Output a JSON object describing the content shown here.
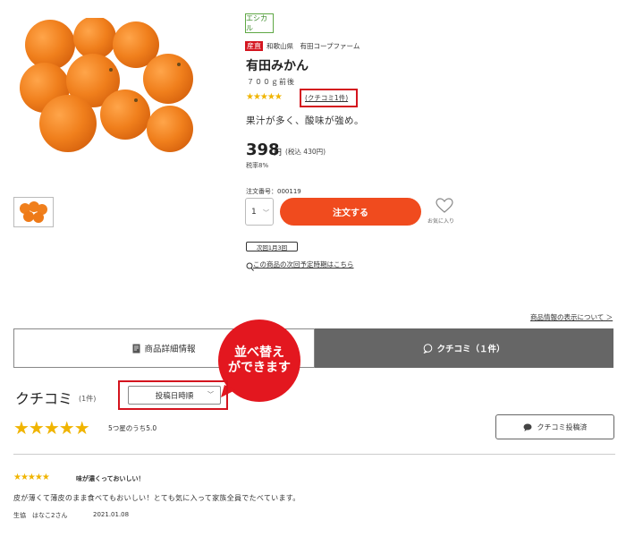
{
  "product": {
    "ethical_badge": "エシカル",
    "origin_tag": "産直",
    "origin_text": "和歌山県　有田コープファーム",
    "name": "有田みかん",
    "weight": "７００ｇ前後",
    "stars": "★★★★★",
    "review_link": "(クチコミ1件)",
    "description": "果汁が多く、酸味が強め。",
    "price": "398",
    "yen": "円",
    "tax_included": "(税込 430円)",
    "tax_rate": "税率8%",
    "order_number": "注文番号：000119",
    "quantity": "1",
    "order_button": "注文する",
    "favorite_label": "お気に入り",
    "next_badge": "次回1月3回",
    "schedule_link": "この商品の次回予定時期はこちら",
    "display_link": "商品情報の表示について ＞"
  },
  "tabs": {
    "detail": "商品詳細情報",
    "review": "クチコミ（１件）"
  },
  "annotation": {
    "line1": "並べ替え",
    "line2": "ができます"
  },
  "reviews": {
    "title": "クチコミ",
    "count": "(1件)",
    "sort_value": "投稿日時順",
    "stars": "★★★★★",
    "rating_text": "5つ星のうち5.0",
    "post_button": "クチコミ投稿済",
    "items": [
      {
        "stars": "★★★★★",
        "title": "味が濃くっておいしい！",
        "body": "皮が薄くて薄皮のまま食べてもおいしい！とても気に入って家族全員でたべています。",
        "author": "生協　はなこ2さん",
        "date": "2021.01.08"
      }
    ]
  },
  "colors": {
    "accent_red": "#d4141e",
    "order_orange": "#f04b1e",
    "star_gold": "#f0b400",
    "tab_active": "#666666"
  }
}
